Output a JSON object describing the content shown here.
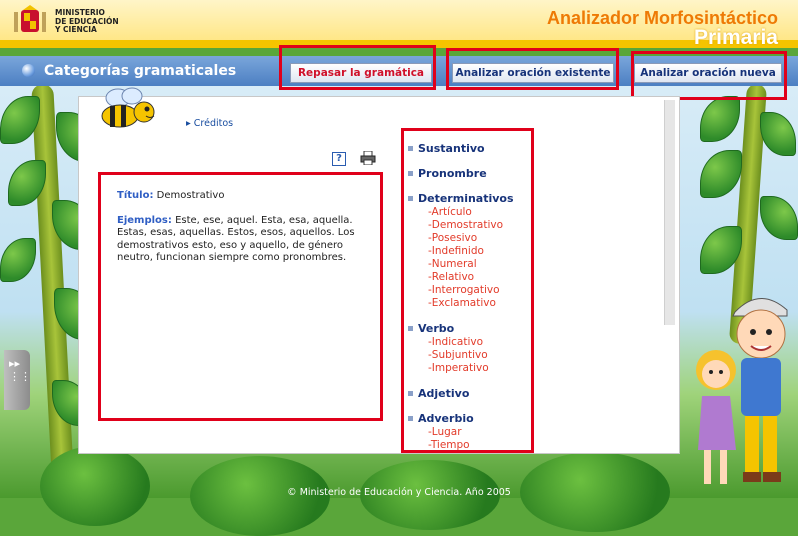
{
  "header": {
    "ministry": "MINISTERIO\nDE EDUCACIÓN\nY CIENCIA",
    "app_title": "Analizador Morfosintáctico",
    "app_subtitle": "Primaria"
  },
  "nav": {
    "section_title": "Categorías gramaticales",
    "buttons": [
      "Repasar la gramática",
      "Analizar oración existente",
      "Analizar oración nueva"
    ],
    "button_colors": [
      "#d0102a",
      "#17337a",
      "#17337a"
    ]
  },
  "panel": {
    "creditos": "Créditos",
    "help_icon": "help-icon",
    "print_icon": "printer-icon",
    "titulo_label": "Título:",
    "titulo_value": "Demostrativo",
    "ejemplos_label": "Ejemplos:",
    "ejemplos_value": "Este, ese, aquel. Esta, esa, aquella. Estas, esas, aquellas. Estos, esos, aquellos. Los demostrativos esto, eso y aquello, de género neutro, funcionan siempre como pronombres."
  },
  "categories": [
    {
      "label": "Sustantivo",
      "subs": []
    },
    {
      "label": "Pronombre",
      "subs": []
    },
    {
      "label": "Determinativos",
      "subs": [
        "-Artículo",
        "-Demostrativo",
        "-Posesivo",
        "-Indefinido",
        "-Numeral",
        "-Relativo",
        "-Interrogativo",
        "-Exclamativo"
      ]
    },
    {
      "label": "Verbo",
      "subs": [
        "-Indicativo",
        "-Subjuntivo",
        "-Imperativo"
      ]
    },
    {
      "label": "Adjetivo",
      "subs": []
    },
    {
      "label": "Adverbio",
      "subs": [
        "-Lugar",
        "-Tiempo"
      ]
    }
  ],
  "footer": "© Ministerio de Educación y Ciencia. Año 2005",
  "colors": {
    "accent_red": "#e0001a",
    "title_orange": "#ee7a05",
    "nav_blue": "#4c7fc2",
    "sub_red": "#e23b2a"
  }
}
